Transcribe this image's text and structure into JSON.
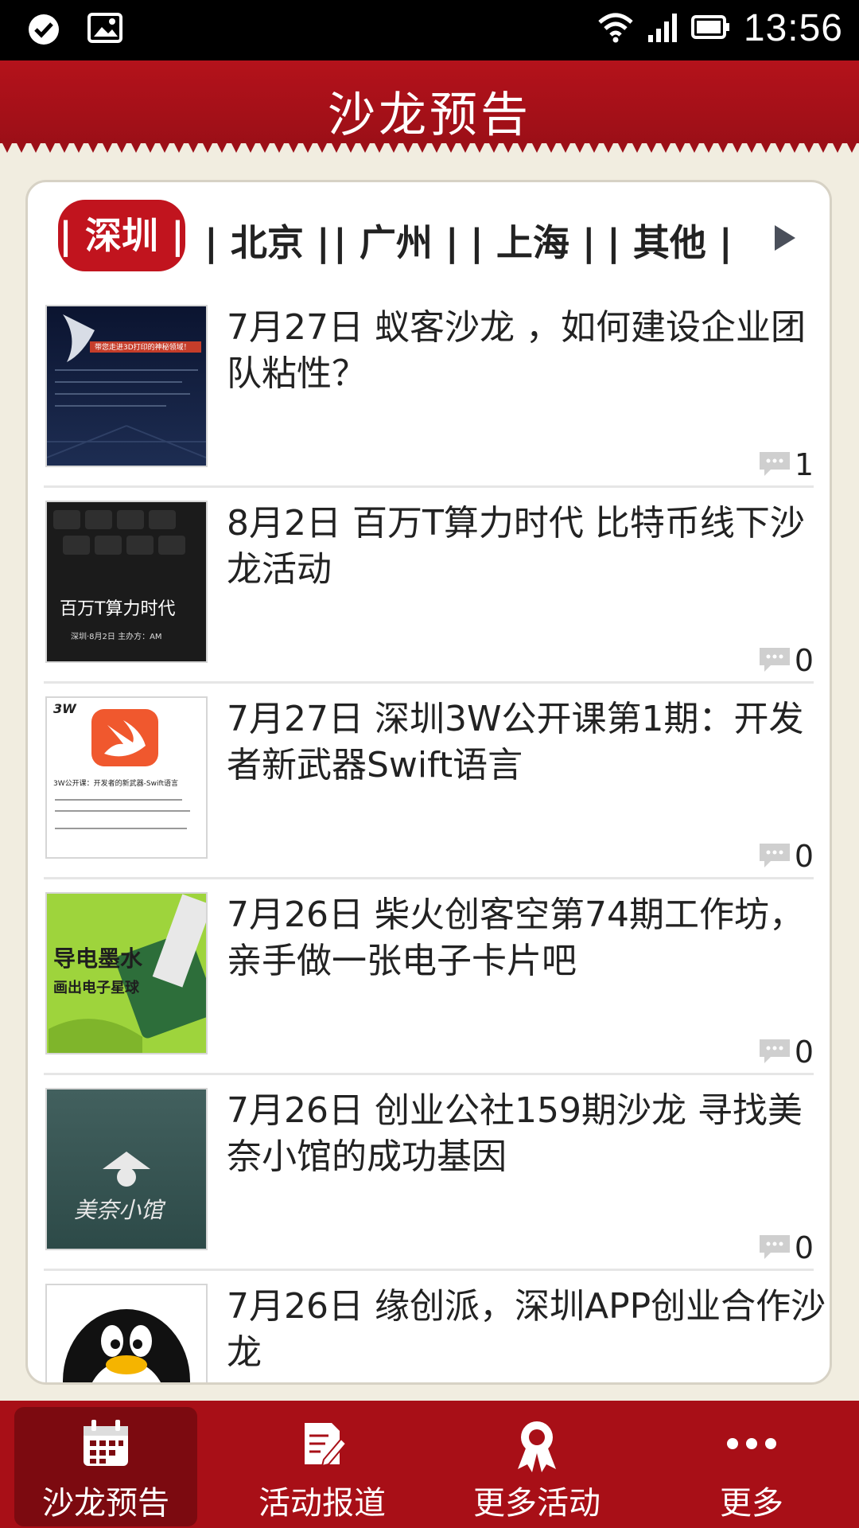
{
  "status": {
    "time": "13:56",
    "left_icons": [
      "check-circle-icon",
      "image-icon"
    ],
    "right_icons": [
      "wifi-icon",
      "signal-icon",
      "battery-icon"
    ]
  },
  "header": {
    "title": "沙龙预告"
  },
  "cities": {
    "active": "| 深圳 |",
    "tabs": [
      "| 北京 |",
      "| 广州 |",
      "| 上海 |",
      "| 其他 |"
    ]
  },
  "events": [
    {
      "title": "7月27日 蚁客沙龙 ，如何建设企业团队粘性？",
      "comments": "1",
      "thumb_text": "带您走进3D打印的神秘领域！"
    },
    {
      "title": "8月2日 百万T算力时代 比特币线下沙龙活动",
      "comments": "0",
      "thumb_text": "百万T算力时代",
      "thumb_sub": "深圳·8月2日 主办方：AM"
    },
    {
      "title": "7月27日 深圳3W公开课第1期：开发者新武器Swift语言",
      "comments": "0",
      "thumb_text": "3W公开课：开发者的新武器-Swift语言",
      "thumb_logo": "3W"
    },
    {
      "title": "7月26日 柴火创客空第74期工作坊，亲手做一张电子卡片吧",
      "comments": "0",
      "thumb_text": "导电墨水",
      "thumb_sub": "画出电子星球"
    },
    {
      "title": "7月26日 创业公社159期沙龙 寻找美奈小馆的成功基因",
      "comments": "0",
      "thumb_text": "美奈小馆"
    },
    {
      "title": "7月26日 缘创派，深圳APP创业合作沙龙",
      "comments": "",
      "thumb_text": ""
    }
  ],
  "nav": [
    {
      "label": "沙龙预告",
      "icon": "calendar-icon",
      "active": true
    },
    {
      "label": "活动报道",
      "icon": "edit-note-icon",
      "active": false
    },
    {
      "label": "更多活动",
      "icon": "award-ribbon-icon",
      "active": false
    },
    {
      "label": "更多",
      "icon": "more-dots-icon",
      "active": false
    }
  ],
  "colors": {
    "brand_red": "#b4121b",
    "nav_active": "#7c0a10",
    "background": "#f1ede0"
  }
}
